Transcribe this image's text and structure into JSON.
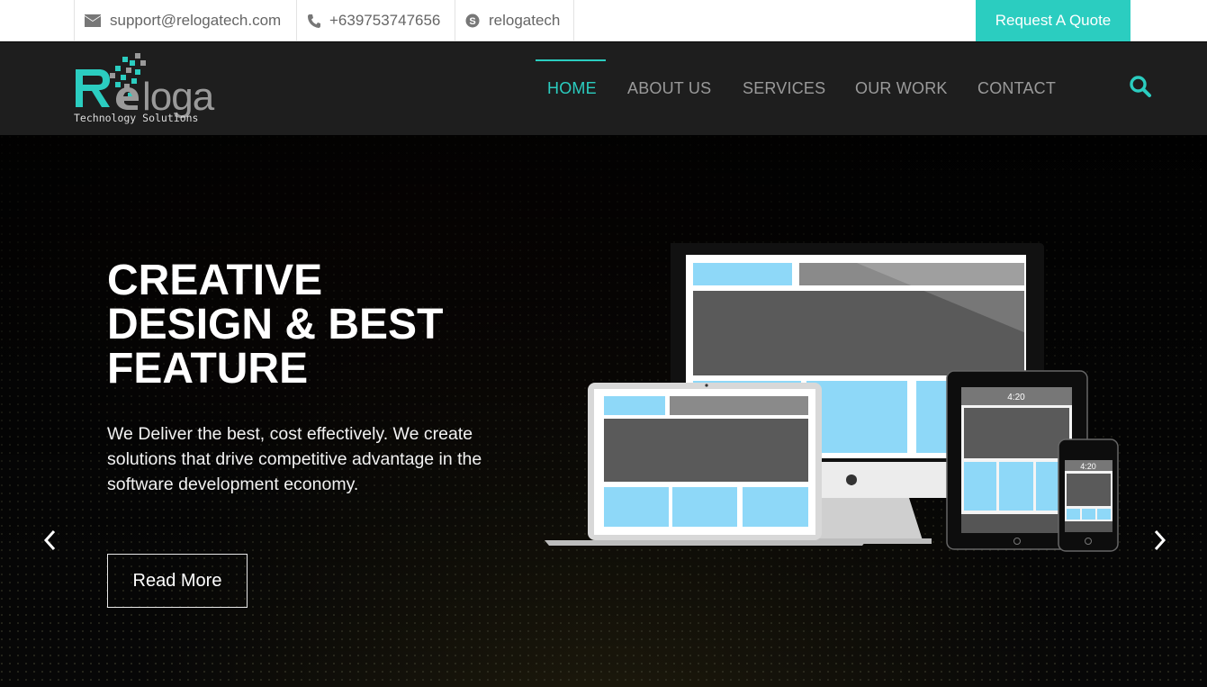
{
  "topbar": {
    "email": "support@relogatech.com",
    "phone": "+639753747656",
    "skype": "relogatech",
    "quote_label": "Request A Quote",
    "icons": {
      "email": "envelope-icon",
      "phone": "phone-icon",
      "skype": "skype-icon"
    }
  },
  "logo": {
    "name": "Reloga",
    "tagline": "Technology Solutions"
  },
  "nav": {
    "items": [
      {
        "label": "HOME",
        "active": true
      },
      {
        "label": "ABOUT US",
        "active": false
      },
      {
        "label": "SERVICES",
        "active": false
      },
      {
        "label": "OUR WORK",
        "active": false
      },
      {
        "label": "CONTACT",
        "active": false
      }
    ],
    "search_icon": "search-icon"
  },
  "hero": {
    "title_lines": [
      "CREATIVE",
      "DESIGN & BEST",
      "FEATURE"
    ],
    "text": "We Deliver the best, cost effectively. We create solutions that drive competitive advantage in the software development economy.",
    "button_label": "Read More",
    "prev_icon": "chevron-left-icon",
    "next_icon": "chevron-right-icon",
    "tablet_time": "4:20",
    "phone_time": "4:20"
  },
  "colors": {
    "accent": "#2bcdc0",
    "nav_bg": "#1e1e1e",
    "hero_bg": "#070707",
    "screen_blue": "#8ed8f8",
    "screen_gray": "#5a5a5a"
  }
}
